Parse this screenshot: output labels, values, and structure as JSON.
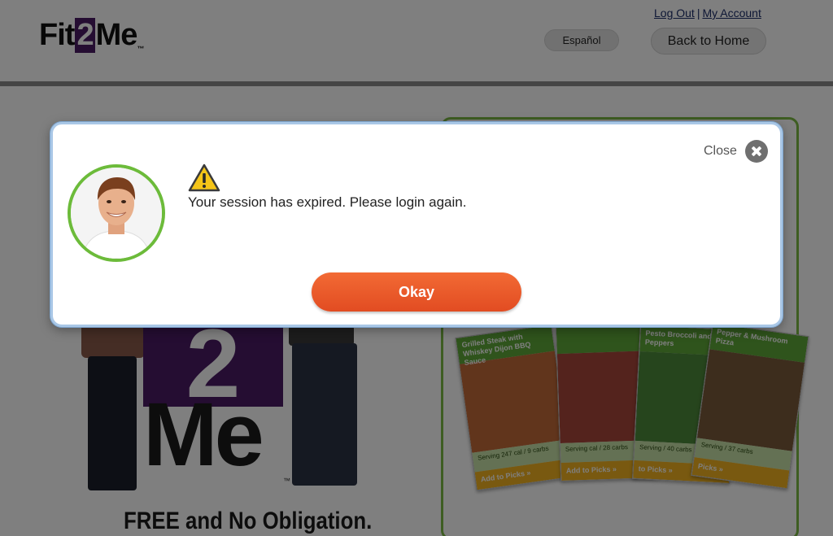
{
  "header": {
    "logo_text_a": "Fit",
    "logo_text_b": "2",
    "logo_text_c": "Me",
    "logo_tm": "™",
    "logout_label": "Log Out",
    "separator": "|",
    "my_account_label": "My Account",
    "language_label": "Español",
    "back_home_label": "Back to Home"
  },
  "background": {
    "hero_two": "2",
    "hero_me": "Me",
    "hero_tm": "™",
    "tagline": "FREE and No Obligation.",
    "cards": [
      {
        "title": "Grilled Steak with Whiskey Dijon BBQ Sauce",
        "serving": "Serving 247 cal / 9 carbs",
        "pick": "Add to Picks »"
      },
      {
        "title": "",
        "serving": "Serving cal / 28 carbs",
        "pick": "Add to Picks »"
      },
      {
        "title": "Pesto Broccoli and Peppers",
        "serving": "Serving / 40 carbs",
        "pick": "to Picks »"
      },
      {
        "title": "Pepper & Mushroom Pizza",
        "serving": "Serving / 37 carbs",
        "pick": "Picks »"
      }
    ]
  },
  "modal": {
    "close_label": "Close",
    "message": "Your session has expired. Please login again.",
    "okay_label": "Okay",
    "colors": {
      "okay_button": "#e8582a",
      "avatar_ring": "#6cbb3a",
      "warning_fill": "#f5c518"
    }
  }
}
